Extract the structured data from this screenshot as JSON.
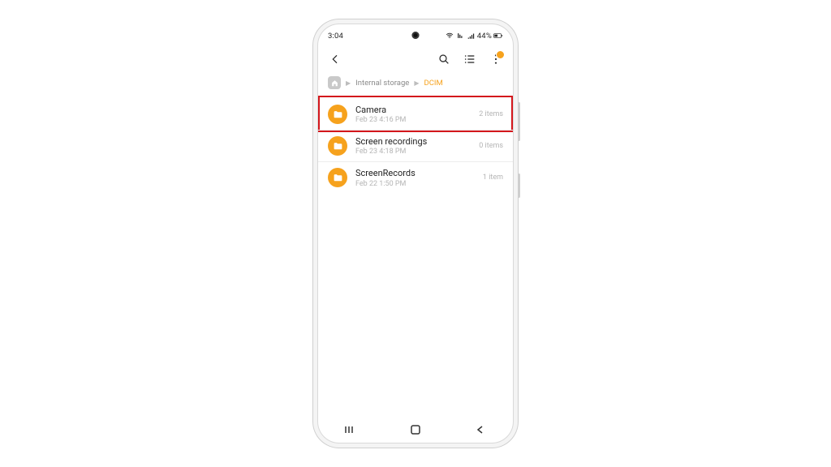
{
  "statusbar": {
    "time": "3:04",
    "battery_text": "44%"
  },
  "toolbar": {},
  "breadcrumb": {
    "seg1": "Internal storage",
    "seg2": "DCIM"
  },
  "folders": [
    {
      "name": "Camera",
      "date": "Feb 23 4:16 PM",
      "count": "2 items"
    },
    {
      "name": "Screen recordings",
      "date": "Feb 23 4:18 PM",
      "count": "0 items"
    },
    {
      "name": "ScreenRecords",
      "date": "Feb 22 1:50 PM",
      "count": "1 item"
    }
  ],
  "highlight_index": 0
}
